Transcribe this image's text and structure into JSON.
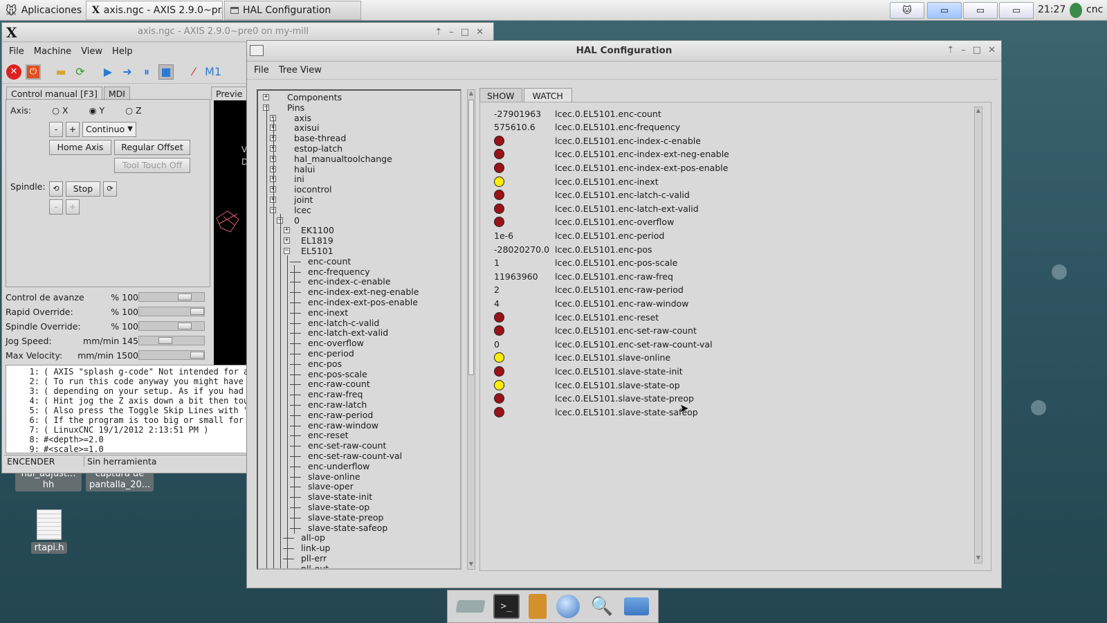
{
  "topbar": {
    "apps_label": "Aplicaciones",
    "tasks": [
      "axis.ngc - AXIS 2.9.0~pr...",
      "HAL Configuration"
    ],
    "clock": "21:27",
    "user": "cnc"
  },
  "desktop": {
    "icons": [
      {
        "label_line1": "hal_adjust...",
        "label_line2": "hh"
      },
      {
        "label_line1": "captura de",
        "label_line2": "pantalla_20..."
      },
      {
        "label": "rtapi.h"
      }
    ]
  },
  "axis": {
    "title": "axis.ngc - AXIS 2.9.0~pre0 on my-mill",
    "menu": [
      "File",
      "Machine",
      "View",
      "Help"
    ],
    "tabs": [
      "Control manual [F3]",
      "MDI"
    ],
    "preview_tab": "Previe",
    "axis_label": "Axis:",
    "axis_options": [
      "X",
      "Y",
      "Z"
    ],
    "selected_axis": "Y",
    "minus": "-",
    "plus": "+",
    "jog_mode": "Continuo",
    "home_axis": "Home Axis",
    "regular_offset": "Regular Offset",
    "tool_touch_off": "Tool Touch Off",
    "spindle_label": "Spindle:",
    "stop": "Stop",
    "overrides": [
      {
        "label": "Control de avanze",
        "value": "100 %",
        "level": 0.75
      },
      {
        "label": "Rapid Override:",
        "value": "100 %",
        "level": 1.0
      },
      {
        "label": "Spindle Override:",
        "value": "100 %",
        "level": 0.75
      },
      {
        "label": "Jog Speed:",
        "value": "145 mm/min",
        "level": 0.38
      },
      {
        "label": "Max Velocity:",
        "value": "1500 mm/min",
        "level": 1.0
      }
    ],
    "gcode": [
      {
        "n": "1:",
        "t": "( AXIS \"splash g-code\" Not intended for ac"
      },
      {
        "n": "2:",
        "t": "( To run this code anyway you might have t"
      },
      {
        "n": "3:",
        "t": "( depending on your setup. As if you had s"
      },
      {
        "n": "4:",
        "t": "( Hint jog the Z axis down a bit then touc"
      },
      {
        "n": "5:",
        "t": "( Also press the Toggle Skip Lines with \"/"
      },
      {
        "n": "6:",
        "t": "( If the program is too big or small for y"
      },
      {
        "n": "7:",
        "t": "( LinuxCNC 19/1/2012 2:13:51 PM )"
      },
      {
        "n": "8:",
        "t": "#<depth>=2.0"
      },
      {
        "n": "9:",
        "t": "#<scale>=1.0"
      }
    ],
    "status_state": "ENCENDER",
    "status_tool": "Sin herramienta",
    "preview_text": [
      "V",
      "D"
    ]
  },
  "hal": {
    "title": "HAL Configuration",
    "menu": [
      "File",
      "Tree View"
    ],
    "tabs": [
      "SHOW",
      "WATCH"
    ],
    "active_tab": "WATCH",
    "tree": {
      "components": "Components",
      "pins": "Pins",
      "pin_groups": [
        "axis",
        "axisui",
        "base-thread",
        "estop-latch",
        "hal_manualtoolchange",
        "halui",
        "ini",
        "iocontrol",
        "joint"
      ],
      "lcec": "lcec",
      "lcec_0": "0",
      "devices": [
        "EK1100",
        "EL1819"
      ],
      "el5101": "EL5101",
      "el5101_pins": [
        "enc-count",
        "enc-frequency",
        "enc-index-c-enable",
        "enc-index-ext-neg-enable",
        "enc-index-ext-pos-enable",
        "enc-inext",
        "enc-latch-c-valid",
        "enc-latch-ext-valid",
        "enc-overflow",
        "enc-period",
        "enc-pos",
        "enc-pos-scale",
        "enc-raw-count",
        "enc-raw-freq",
        "enc-raw-latch",
        "enc-raw-period",
        "enc-raw-window",
        "enc-reset",
        "enc-set-raw-count",
        "enc-set-raw-count-val",
        "enc-underflow",
        "slave-online",
        "slave-oper",
        "slave-state-init",
        "slave-state-op",
        "slave-state-preop",
        "slave-state-safeop"
      ],
      "lcec_pins": [
        "all-op",
        "link-up",
        "pll-err",
        "pll-out"
      ]
    },
    "watch": [
      {
        "value": "-27901963",
        "pin": "lcec.0.EL5101.enc-count"
      },
      {
        "value": "575610.6",
        "pin": "lcec.0.EL5101.enc-frequency"
      },
      {
        "led": "off",
        "pin": "lcec.0.EL5101.enc-index-c-enable"
      },
      {
        "led": "off",
        "pin": "lcec.0.EL5101.enc-index-ext-neg-enable"
      },
      {
        "led": "off",
        "pin": "lcec.0.EL5101.enc-index-ext-pos-enable"
      },
      {
        "led": "on",
        "pin": "lcec.0.EL5101.enc-inext"
      },
      {
        "led": "off",
        "pin": "lcec.0.EL5101.enc-latch-c-valid"
      },
      {
        "led": "off",
        "pin": "lcec.0.EL5101.enc-latch-ext-valid"
      },
      {
        "led": "off",
        "pin": "lcec.0.EL5101.enc-overflow"
      },
      {
        "value": "1e-6",
        "pin": "lcec.0.EL5101.enc-period"
      },
      {
        "value": "-28020270.0",
        "pin": "lcec.0.EL5101.enc-pos"
      },
      {
        "value": "1",
        "pin": "lcec.0.EL5101.enc-pos-scale"
      },
      {
        "value": "11963960",
        "pin": "lcec.0.EL5101.enc-raw-freq"
      },
      {
        "value": "2",
        "pin": "lcec.0.EL5101.enc-raw-period"
      },
      {
        "value": "4",
        "pin": "lcec.0.EL5101.enc-raw-window"
      },
      {
        "led": "off",
        "pin": "lcec.0.EL5101.enc-reset"
      },
      {
        "led": "off",
        "pin": "lcec.0.EL5101.enc-set-raw-count"
      },
      {
        "value": "0",
        "pin": "lcec.0.EL5101.enc-set-raw-count-val"
      },
      {
        "led": "on",
        "pin": "lcec.0.EL5101.slave-online"
      },
      {
        "led": "off",
        "pin": "lcec.0.EL5101.slave-state-init"
      },
      {
        "led": "on",
        "pin": "lcec.0.EL5101.slave-state-op"
      },
      {
        "led": "off",
        "pin": "lcec.0.EL5101.slave-state-preop"
      },
      {
        "led": "off",
        "pin": "lcec.0.EL5101.slave-state-safeop"
      }
    ]
  },
  "colors": {
    "led_on": "#ffee00",
    "led_off": "#9b1218",
    "desktop": "#2e5561"
  },
  "dock_icons": [
    "drive-icon",
    "terminal-icon",
    "file-cabinet-icon",
    "globe-icon",
    "search-icon",
    "folder-icon"
  ]
}
